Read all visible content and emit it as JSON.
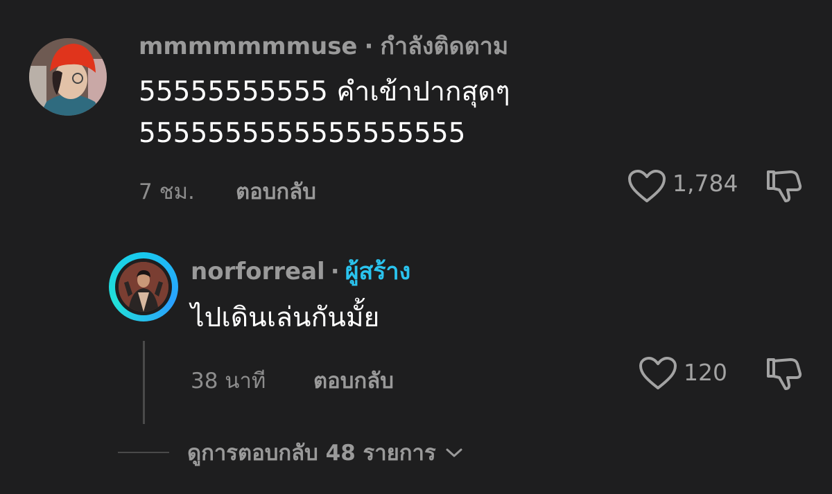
{
  "comment": {
    "username": "mmmmmmmuse",
    "separator": "·",
    "follow_status": "กำลังติดตาม",
    "text": "55555555555 คำเข้าปากสุดๆ\n5555555555555555555",
    "time": "7 ชม.",
    "reply_label": "ตอบกลับ",
    "like_count": "1,784"
  },
  "reply": {
    "username": "norforreal",
    "separator": "·",
    "badge": "ผู้สร้าง",
    "text": "ไปเดินเล่นกันมั้ย",
    "time": "38 นาที",
    "reply_label": "ตอบกลับ",
    "like_count": "120"
  },
  "view_replies": {
    "label": "ดูการตอบกลับ 48 รายการ"
  },
  "colors": {
    "background": "#1e1e1f",
    "creator_accent": "#2ac3ee",
    "muted_text": "#9a9a9a"
  },
  "icons": [
    "heart-icon",
    "dislike-icon",
    "chevron-down-icon"
  ]
}
